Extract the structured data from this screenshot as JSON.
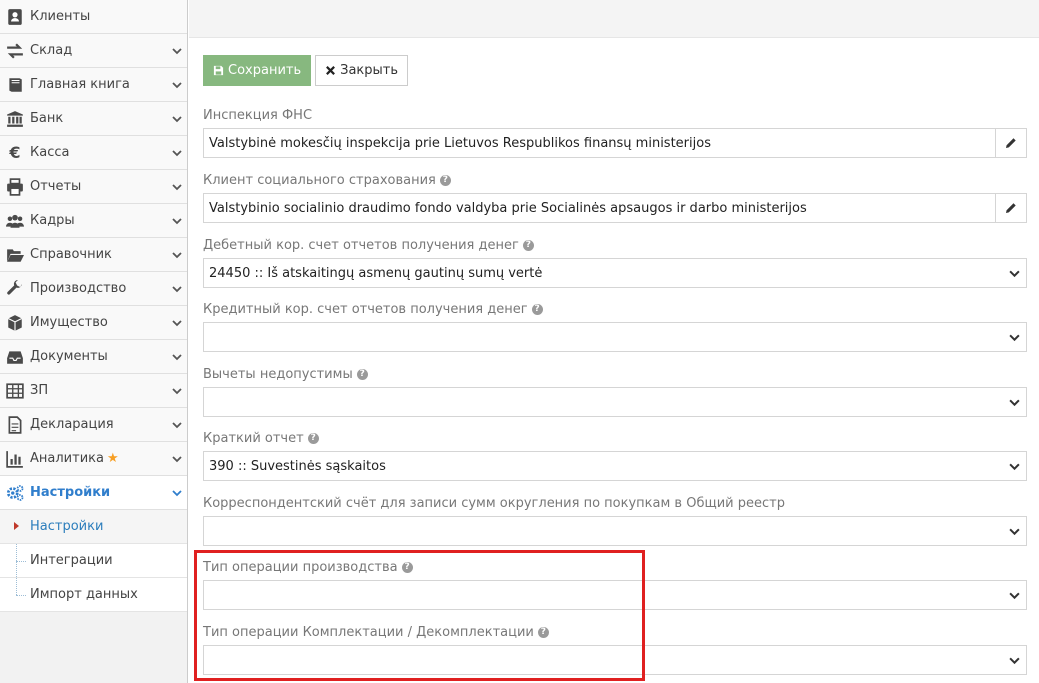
{
  "sidebar": {
    "items": [
      {
        "label": "Клиенты",
        "icon": "contact-card-icon",
        "chevron": false
      },
      {
        "label": "Склад",
        "icon": "exchange-arrows-icon",
        "chevron": true
      },
      {
        "label": "Главная книга",
        "icon": "book-icon",
        "chevron": true
      },
      {
        "label": "Банк",
        "icon": "bank-icon",
        "chevron": true
      },
      {
        "label": "Касса",
        "icon": "euro-icon",
        "chevron": true
      },
      {
        "label": "Отчеты",
        "icon": "printer-icon",
        "chevron": true
      },
      {
        "label": "Кадры",
        "icon": "users-icon",
        "chevron": true
      },
      {
        "label": "Справочник",
        "icon": "folder-open-icon",
        "chevron": true
      },
      {
        "label": "Производство",
        "icon": "wrench-icon",
        "chevron": true
      },
      {
        "label": "Имущество",
        "icon": "cube-icon",
        "chevron": true
      },
      {
        "label": "Документы",
        "icon": "inbox-icon",
        "chevron": true
      },
      {
        "label": "ЗП",
        "icon": "table-icon",
        "chevron": true
      },
      {
        "label": "Декларация",
        "icon": "document-icon",
        "chevron": true
      },
      {
        "label": "Аналитика",
        "icon": "bar-chart-icon",
        "chevron": true,
        "star": true
      },
      {
        "label": "Настройки",
        "icon": "gears-icon",
        "chevron": true,
        "active": true
      }
    ],
    "sub_items": [
      {
        "label": "Настройки",
        "active": true
      },
      {
        "label": "Интеграции"
      },
      {
        "label": "Импорт данных"
      }
    ]
  },
  "toolbar": {
    "save_label": "Сохранить",
    "close_label": "Закрыть"
  },
  "form": {
    "fields": [
      {
        "label": "Инспекция ФНС",
        "value": "Valstybinė mokesčių inspekcija prie Lietuvos Respublikos finansų ministerijos",
        "type": "edit",
        "help": false
      },
      {
        "label": "Клиент социального страхования",
        "value": "Valstybinio socialinio draudimo fondo valdyba prie Socialinės apsaugos ir darbo ministerijos",
        "type": "edit",
        "help": true
      },
      {
        "label": "Дебетный кор. счет отчетов получения денег",
        "value": "24450 :: Iš atskaitingų asmenų gautinų sumų vertė",
        "type": "select",
        "help": true
      },
      {
        "label": "Кредитный кор. счет отчетов получения денег",
        "value": "",
        "type": "select",
        "help": true
      },
      {
        "label": "Вычеты недопустимы",
        "value": "",
        "type": "select",
        "help": true
      },
      {
        "label": "Краткий отчет",
        "value": "390 :: Suvestinės sąskaitos",
        "type": "select",
        "help": true
      },
      {
        "label": "Корреспондентский счёт для записи сумм округления по покупкам в Общий реестр",
        "value": "",
        "type": "select",
        "help": false
      },
      {
        "label": "Тип операции производства",
        "value": "",
        "type": "select",
        "help": true
      },
      {
        "label": "Тип операции Комплектации / Декомплектации",
        "value": "",
        "type": "select",
        "help": true
      }
    ]
  },
  "colors": {
    "accent": "#307ecc",
    "save_button": "#87b87f",
    "highlight": "#e02020",
    "star": "#f79f24"
  }
}
